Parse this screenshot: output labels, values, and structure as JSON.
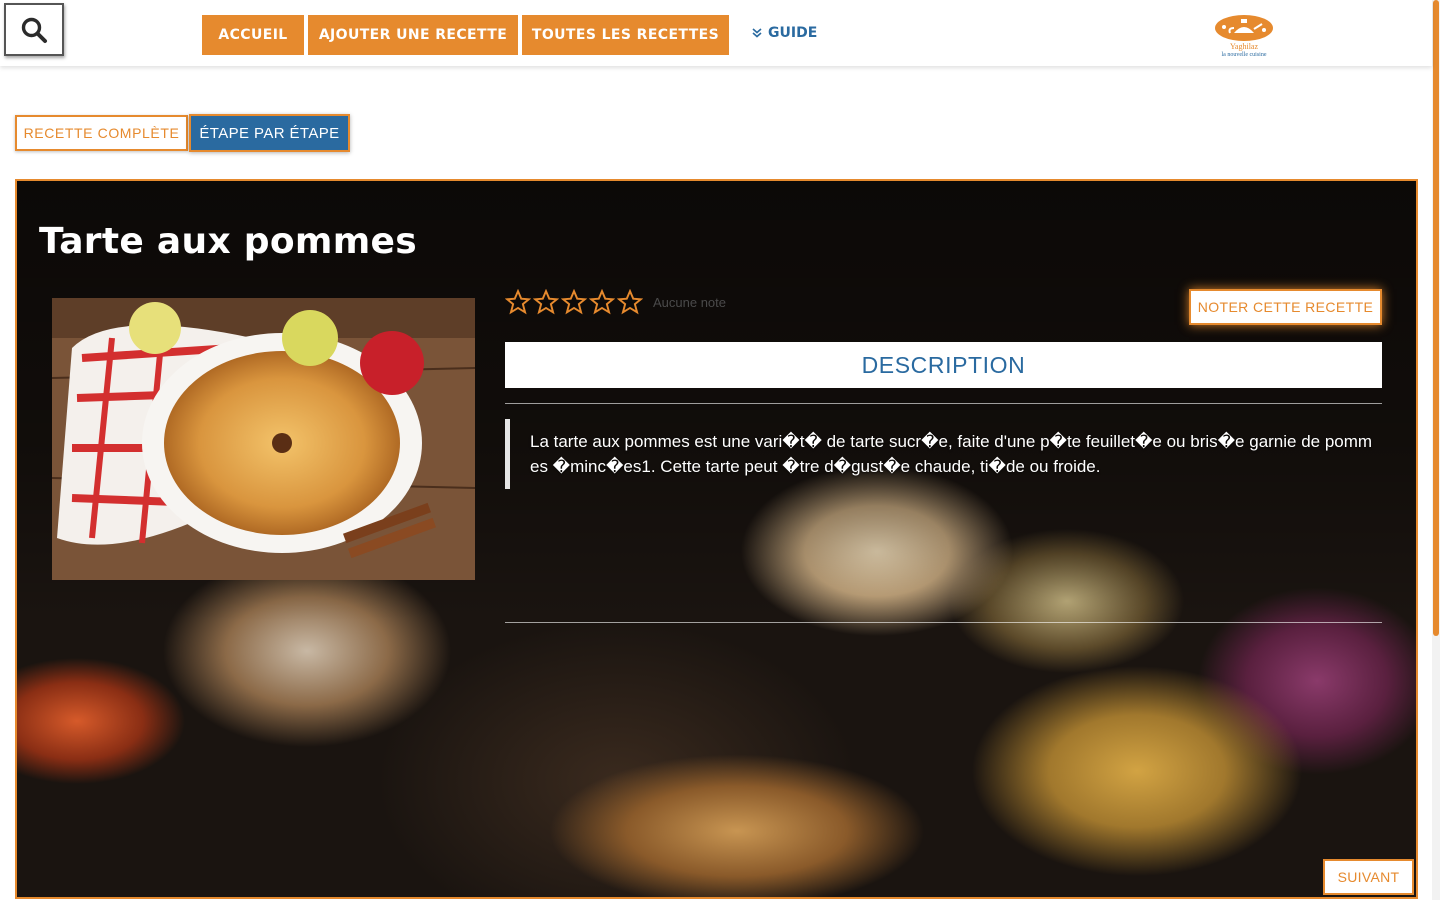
{
  "nav": {
    "search_icon": "search-icon",
    "accueil": "Accueil",
    "ajouter": "Ajouter une recette",
    "toutes": "Toutes les recettes",
    "guide": "Guide",
    "guide_icon": "chevron-double-down-icon"
  },
  "logo": {
    "name": "Yaghilaz",
    "tagline": "la nouvelle cuisine"
  },
  "tabs": {
    "complete": "Recette complète",
    "etape": "Étape par étape",
    "active": "etape"
  },
  "recipe": {
    "title": "Tarte aux pommes",
    "rating_label": "Aucune note",
    "stars_filled": 0,
    "stars_total": 5,
    "rate_button": "Noter cette recette",
    "description_header": "Description",
    "description": "La tarte aux pommes est une vari�t� de tarte sucr�e, faite d'une p�te feuillet�e ou bris�e garnie de pommes �minc�es1. Cette tarte peut �tre d�gust�e chaude, ti�de ou froide."
  },
  "pager": {
    "next": "Suivant"
  },
  "colors": {
    "accent_orange": "#e68a2e",
    "primary_blue": "#2a6aa0"
  }
}
